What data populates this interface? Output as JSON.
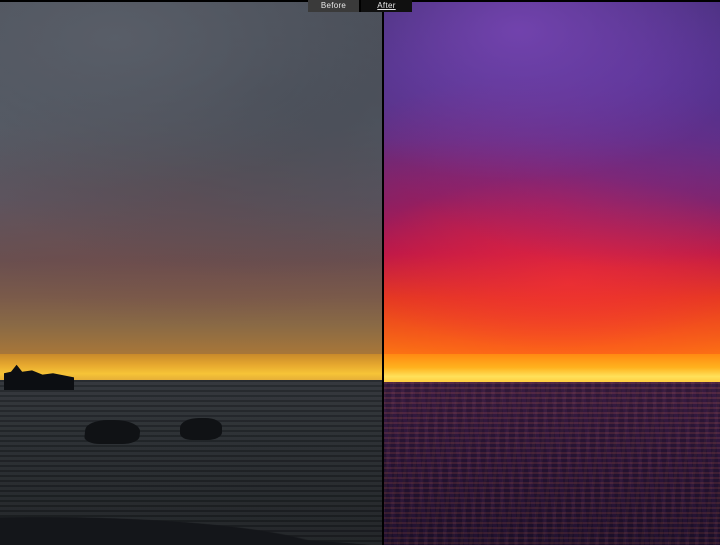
{
  "compare": {
    "before_label": "Before",
    "after_label": "After"
  }
}
